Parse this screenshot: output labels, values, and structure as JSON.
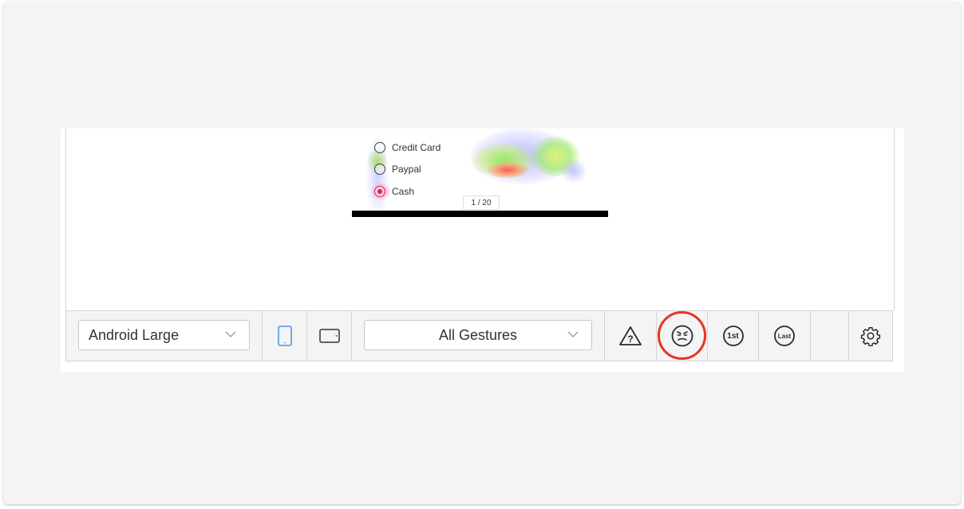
{
  "preview": {
    "options": [
      {
        "label": "Credit Card",
        "selected": false
      },
      {
        "label": "Paypal",
        "selected": false
      },
      {
        "label": "Cash",
        "selected": true
      }
    ],
    "page_indicator": "1 / 20"
  },
  "toolbar": {
    "device_select": {
      "value": "Android Large"
    },
    "gesture_select": {
      "value": "All Gestures"
    },
    "icons": [
      "portrait-phone-icon",
      "landscape-phone-icon",
      "warning-question-icon",
      "frustrated-face-icon",
      "first-gesture-icon",
      "last-gesture-icon",
      "settings-gear-icon"
    ],
    "first_badge": "1st",
    "last_badge": "Last"
  },
  "colors": {
    "accent_blue": "#4a8ef0",
    "highlight_red": "#e8341f",
    "selected_radio": "#d0294a"
  }
}
